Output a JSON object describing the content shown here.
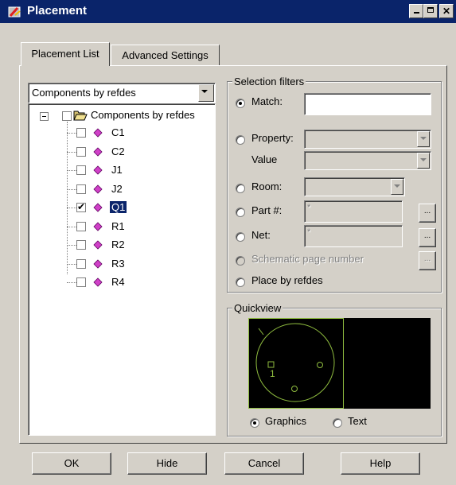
{
  "window": {
    "title": "Placement"
  },
  "tabs": [
    {
      "label": "Placement List"
    },
    {
      "label": "Advanced Settings"
    }
  ],
  "list_dropdown": {
    "value": "Components by refdes"
  },
  "tree": {
    "root_label": "Components by refdes",
    "items": [
      {
        "label": "C1",
        "checked": false,
        "selected": false
      },
      {
        "label": "C2",
        "checked": false,
        "selected": false
      },
      {
        "label": "J1",
        "checked": false,
        "selected": false
      },
      {
        "label": "J2",
        "checked": false,
        "selected": false
      },
      {
        "label": "Q1",
        "checked": true,
        "selected": true
      },
      {
        "label": "R1",
        "checked": false,
        "selected": false
      },
      {
        "label": "R2",
        "checked": false,
        "selected": false
      },
      {
        "label": "R3",
        "checked": false,
        "selected": false
      },
      {
        "label": "R4",
        "checked": false,
        "selected": false
      }
    ]
  },
  "selection_filters": {
    "legend": "Selection filters",
    "match_label": "Match:",
    "match_value": "",
    "property_label": "Property:",
    "value_label": "Value",
    "room_label": "Room:",
    "part_label": "Part #:",
    "part_value": "*",
    "net_label": "Net:",
    "net_value": "*",
    "schematic_label": "Schematic page number",
    "placebyrefdes_label": "Place by refdes",
    "browse_label": "..."
  },
  "quickview": {
    "legend": "Quickview",
    "graphics_label": "Graphics",
    "text_label": "Text",
    "pin_label": "1",
    "selected_mode": "Graphics",
    "colors": {
      "background": "#000000",
      "outline": "#8fbc3f"
    }
  },
  "buttons": {
    "ok": "OK",
    "hide": "Hide",
    "cancel": "Cancel",
    "help": "Help"
  },
  "colors": {
    "title_bar": "#0a246a",
    "dialog": "#d4d0c8",
    "selection": "#0a246a",
    "item_icon": "#d040c8"
  }
}
